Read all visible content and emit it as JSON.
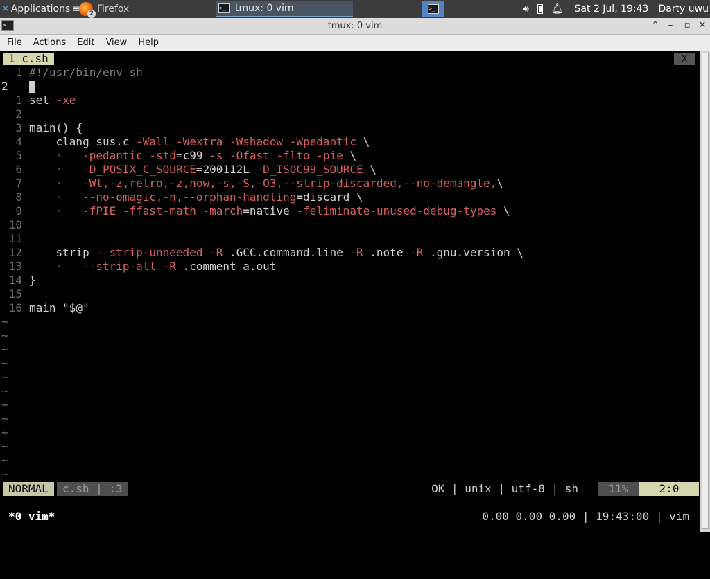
{
  "panel": {
    "app_menu": "Applications",
    "app_menu_suffix": "≡",
    "tasks": [
      {
        "label": "Firefox",
        "badge": "2"
      },
      {
        "label": "tmux: 0 vim"
      }
    ],
    "clock": "Sat  2 Jul, 19:43",
    "user": "Darty uwu"
  },
  "window": {
    "title": "tmux: 0 vim"
  },
  "menubar": [
    "File",
    "Actions",
    "Edit",
    "View",
    "Help"
  ],
  "vim": {
    "tab_label": "1 c.sh",
    "tab_close": "X",
    "lines": [
      {
        "n": "1",
        "text": "#!/usr/bin/env sh"
      },
      {
        "n": "2",
        "text": ""
      },
      {
        "n": "1",
        "text": "set -xe"
      },
      {
        "n": "2",
        "text": ""
      },
      {
        "n": "3",
        "text": "main() {"
      },
      {
        "n": "4",
        "text": "    clang sus.c -Wall -Wextra -Wshadow -Wpedantic \\"
      },
      {
        "n": "5",
        "text": "    ·   -pedantic -std=c99 -s -Ofast -flto -pie \\"
      },
      {
        "n": "6",
        "text": "    ·   -D_POSIX_C_SOURCE=200112L -D_ISOC99_SOURCE \\"
      },
      {
        "n": "7",
        "text": "    ·   -Wl,-z,relro,-z,now,-s,-S,-O3,--strip-discarded,--no-demangle,\\"
      },
      {
        "n": "8",
        "text": "    ·   --no-omagic,-n,--orphan-handling=discard \\"
      },
      {
        "n": "9",
        "text": "    ·   -fPIE -ffast-math -march=native -feliminate-unused-debug-types \\"
      },
      {
        "n": "10",
        "text": ""
      },
      {
        "n": "11",
        "text": ""
      },
      {
        "n": "12",
        "text": "    strip --strip-unneeded -R .GCC.command.line -R .note -R .gnu.version \\"
      },
      {
        "n": "13",
        "text": "    ·   --strip-all -R .comment a.out"
      },
      {
        "n": "14",
        "text": "}"
      },
      {
        "n": "15",
        "text": ""
      },
      {
        "n": "16",
        "text": "main \"$@\""
      }
    ],
    "tilde_rows": 12,
    "status": {
      "mode": "NORMAL",
      "file": "c.sh | :3",
      "right": "OK | unix | utf-8 | sh",
      "percent": "11%",
      "position": "2:0"
    }
  },
  "tmux": {
    "window": "*0 vim*",
    "right": "0.00 0.00 0.00 | 19:43:00 | vim"
  }
}
